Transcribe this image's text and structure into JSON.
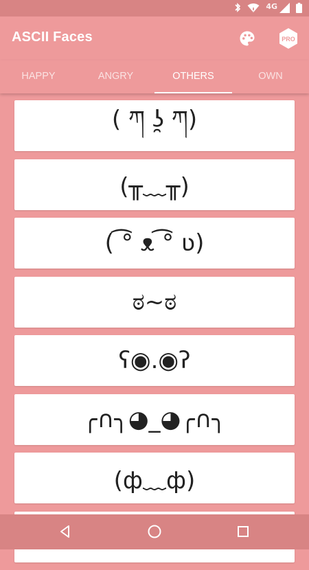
{
  "status_bar": {
    "network": "4G"
  },
  "app_bar": {
    "title": "ASCII Faces",
    "pro_badge": "PRO"
  },
  "tabs": [
    {
      "label": "HAPPY",
      "active": false
    },
    {
      "label": "ANGRY",
      "active": false
    },
    {
      "label": "OTHERS",
      "active": true
    },
    {
      "label": "OWN",
      "active": false
    }
  ],
  "faces": [
    "( ཀ ʖ̯ ཀ)",
    "(╥﹏╥)",
    "( ͡° ᴥ ͡° ʋ)",
    "ಠ~ಠ",
    "ʕ◉.◉ʔ",
    "╭∩╮◕_◕╭∩╮",
    "(ф﹏ф)"
  ],
  "colors": {
    "primary": "#EE9A9B",
    "status_bar": "#D88484",
    "card": "#FFFFFF"
  }
}
